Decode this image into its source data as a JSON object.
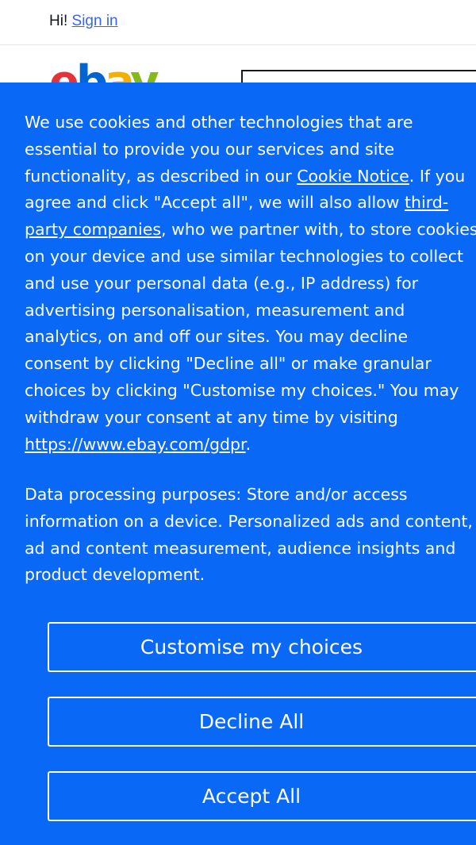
{
  "topbar": {
    "greeting": "Hi!",
    "signin_label": "Sign in"
  },
  "header": {
    "logo_letters": [
      "e",
      "b",
      "a",
      "y"
    ],
    "logo_colors": [
      "#e53238",
      "#0064d2",
      "#f5af02",
      "#86b817"
    ]
  },
  "consent": {
    "background_color": "#0968f6",
    "lines": [
      "We use cookies and other technologies that are",
      "essential to provide you our services and site",
      "functionality, as described in our ",
      "Cookie Notice",
      ". If you",
      "agree and click \"Accept all\", we will also allow ",
      "third-",
      "party companies",
      ", who we partner with, to store cookies",
      "on your device and use similar technologies to collect",
      "and use your personal data (e.g., IP address) for",
      "advertising personalisation, measurement and",
      "analytics, on and off our sites. You may decline",
      "consent by clicking \"Decline all\" or make granular",
      "choices by clicking \"Customise my choices.\" You may",
      "withdraw your consent at any time by visiting",
      "https://www.ebay.com/gdpr",
      "."
    ],
    "purposes_lines": [
      "Data processing purposes: Store and/or access",
      "information on a device. Personalized ads and content,",
      "ad and content measurement, audience insights and",
      "product development."
    ],
    "buttons": {
      "customise": "Customise my choices",
      "decline": "Decline All",
      "accept": "Accept All"
    }
  }
}
